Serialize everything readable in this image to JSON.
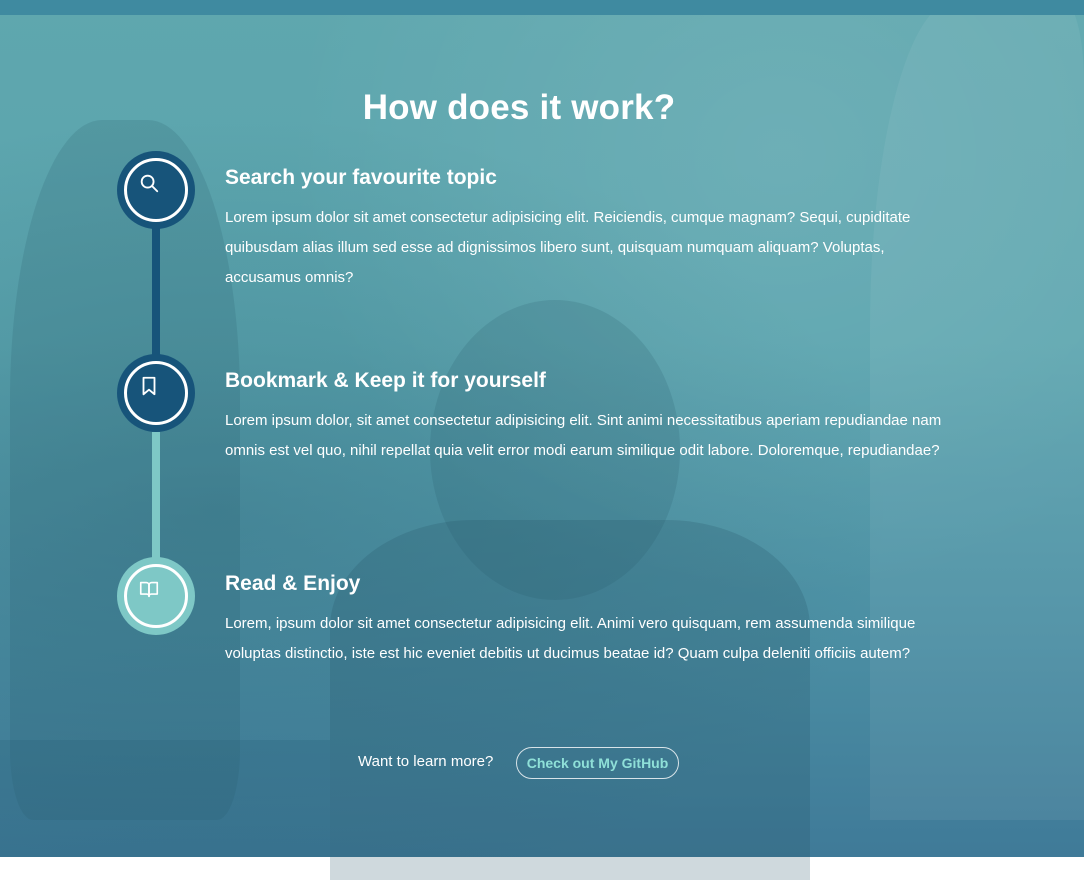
{
  "section": {
    "title": "How does it work?"
  },
  "steps": [
    {
      "icon": "search-icon",
      "title": "Search your favourite topic",
      "text": "Lorem ipsum dolor sit amet consectetur adipisicing elit. Reiciendis, cumque magnam? Sequi, cupiditate quibusdam alias illum sed esse ad dignissimos libero sunt, quisquam numquam aliquam? Voluptas, accusamus omnis?"
    },
    {
      "icon": "bookmark-icon",
      "title": "Bookmark & Keep it for yourself",
      "text": "Lorem ipsum dolor, sit amet consectetur adipisicing elit. Sint animi necessitatibus aperiam repudiandae nam omnis est vel quo, nihil repellat quia velit error modi earum similique odit labore. Doloremque, repudiandae?"
    },
    {
      "icon": "book-open-icon",
      "title": "Read & Enjoy",
      "text": "Lorem, ipsum dolor sit amet consectetur adipisicing elit. Animi vero quisquam, rem assumenda similique voluptas distinctio, iste est hic eveniet debitis ut ducimus beatae id? Quam culpa deleniti officiis autem?"
    }
  ],
  "cta": {
    "prompt": "Want to learn more?",
    "button_label": "Check out My GitHub"
  },
  "colors": {
    "dark_step": "#17547a",
    "light_step": "#7ec8c6",
    "button_text": "#8fe0d8"
  }
}
